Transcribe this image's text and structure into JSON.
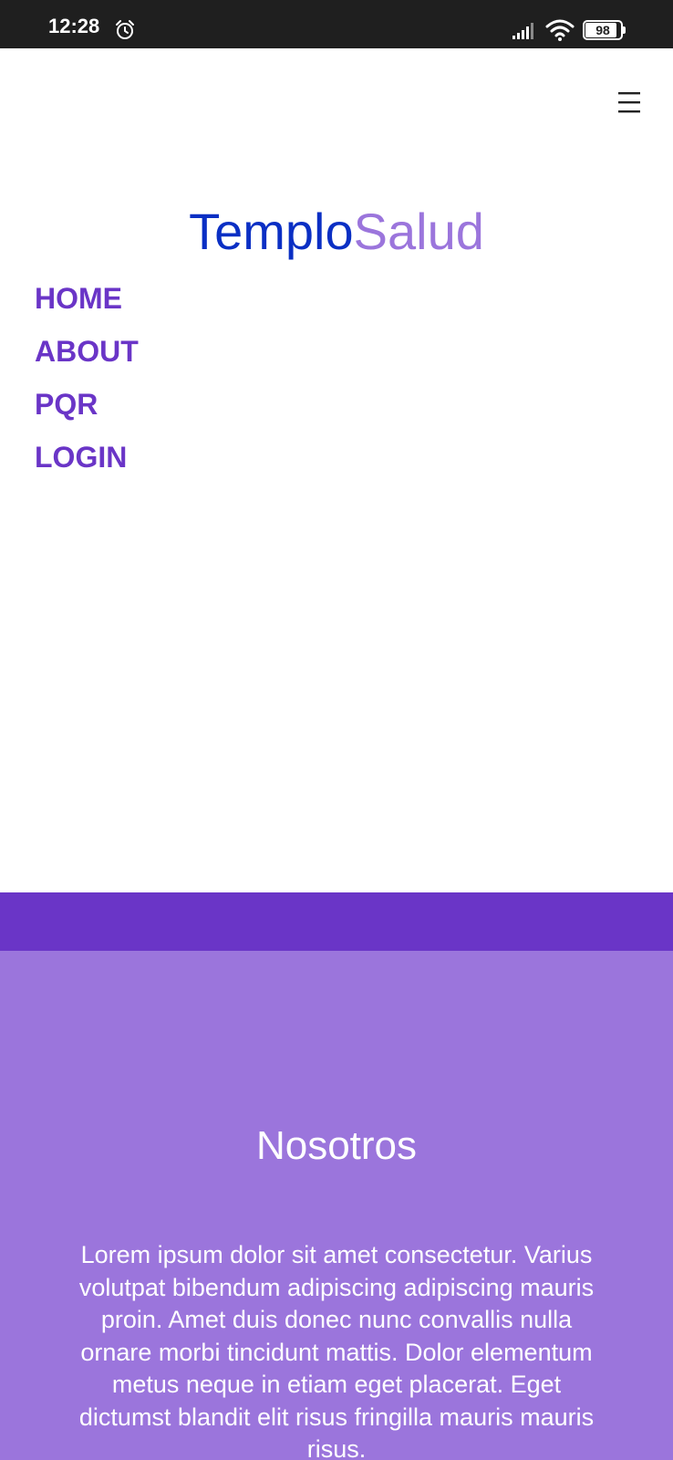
{
  "status_bar": {
    "time": "12:28",
    "battery": "98",
    "icons": [
      "alarm-icon",
      "signal-icon",
      "wifi-icon",
      "battery-icon"
    ]
  },
  "header": {
    "menu_icon": "hamburger-menu-icon",
    "brand_part1": "Templo",
    "brand_part2": "Salud",
    "nav_items": [
      {
        "label": "HOME"
      },
      {
        "label": "ABOUT"
      },
      {
        "label": "PQR"
      },
      {
        "label": "LOGIN"
      }
    ]
  },
  "about": {
    "title": "Nosotros",
    "text": "Lorem ipsum dolor sit amet consectetur. Varius volutpat bibendum adipiscing adipiscing mauris proin. Amet duis donec nunc convallis nulla ornare morbi tincidunt mattis. Dolor elementum metus neque in etiam eget placerat. Eget dictumst blandit elit risus fringilla mauris mauris risus."
  },
  "colors": {
    "status_bar": "#1f1f1f",
    "brand_blue": "#0a2fc4",
    "brand_lavender": "#9b75dc",
    "nav_purple": "#6a35c7",
    "band_dark": "#6a35c7",
    "section_bg": "#9b75dc"
  }
}
